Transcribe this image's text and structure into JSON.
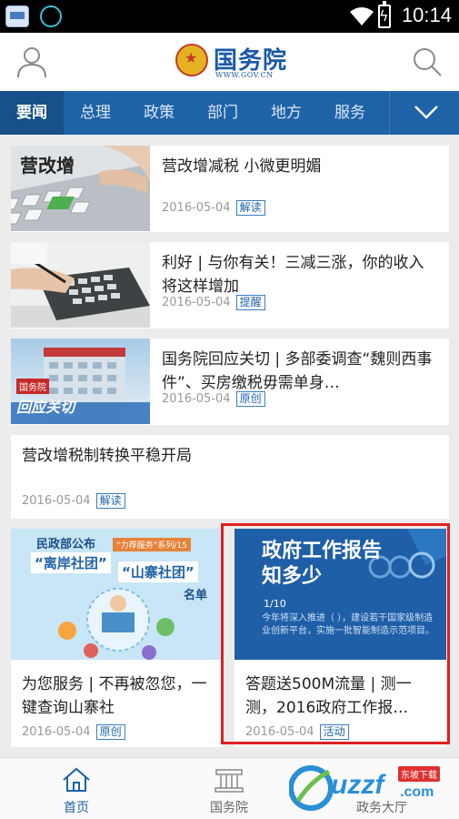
{
  "status_bar": {
    "time": "10:14"
  },
  "header": {
    "logo_title": "国务院",
    "logo_sub": "WWW.GOV.CN"
  },
  "tabs": [
    {
      "label": "要闻",
      "active": true
    },
    {
      "label": "总理"
    },
    {
      "label": "政策"
    },
    {
      "label": "部门"
    },
    {
      "label": "地方"
    },
    {
      "label": "服务"
    }
  ],
  "news": [
    {
      "title": "营改增减税 小微更明媚",
      "date": "2016-05-04",
      "tag": "解读",
      "thumb_text": "营改增"
    },
    {
      "title": "利好 | 与你有关！三减三涨，你的收入将这样增加",
      "date": "2016-05-04",
      "tag": "提醒"
    },
    {
      "title": "国务院回应关切 | 多部委调查“魏则西事件”、买房缴税毋需单身…",
      "date": "2016-05-04",
      "tag": "原创",
      "thumb_badge": "国务院",
      "thumb_text": "回应关切"
    },
    {
      "title": "营改增税制转换平稳开局",
      "date": "2016-05-04",
      "tag": "解读"
    }
  ],
  "cards": [
    {
      "title": "为您服务 | 不再被忽您，一键查询山寨社",
      "date": "2016-05-04",
      "tag": "原创",
      "thumb": {
        "line1": "民政部公布",
        "ribbon": "“力荐服务”系列/15",
        "quote1": "“离岸社团”",
        "quote2": "“山寨社团”",
        "tail": "名单"
      }
    },
    {
      "title": "答题送500M流量 | 测一测，2016政府工作报…",
      "date": "2016-05-04",
      "tag": "活动",
      "thumb": {
        "headline1": "政府工作报告",
        "headline2": "知多少",
        "counter": "1/10",
        "question": "今年将深入推进（ ），建设若干国家级制造业创新平台，实施一批智能制造示范项目。"
      }
    }
  ],
  "bottom_nav": [
    {
      "label": "首页",
      "active": true
    },
    {
      "label": "国务院"
    },
    {
      "label": "政务大厅"
    }
  ],
  "watermark": {
    "text": "uzzf",
    "badge": "东坡下载",
    "domain": ".com"
  },
  "colors": {
    "brand_blue": "#1e62a8",
    "highlight_red": "#e02020"
  }
}
